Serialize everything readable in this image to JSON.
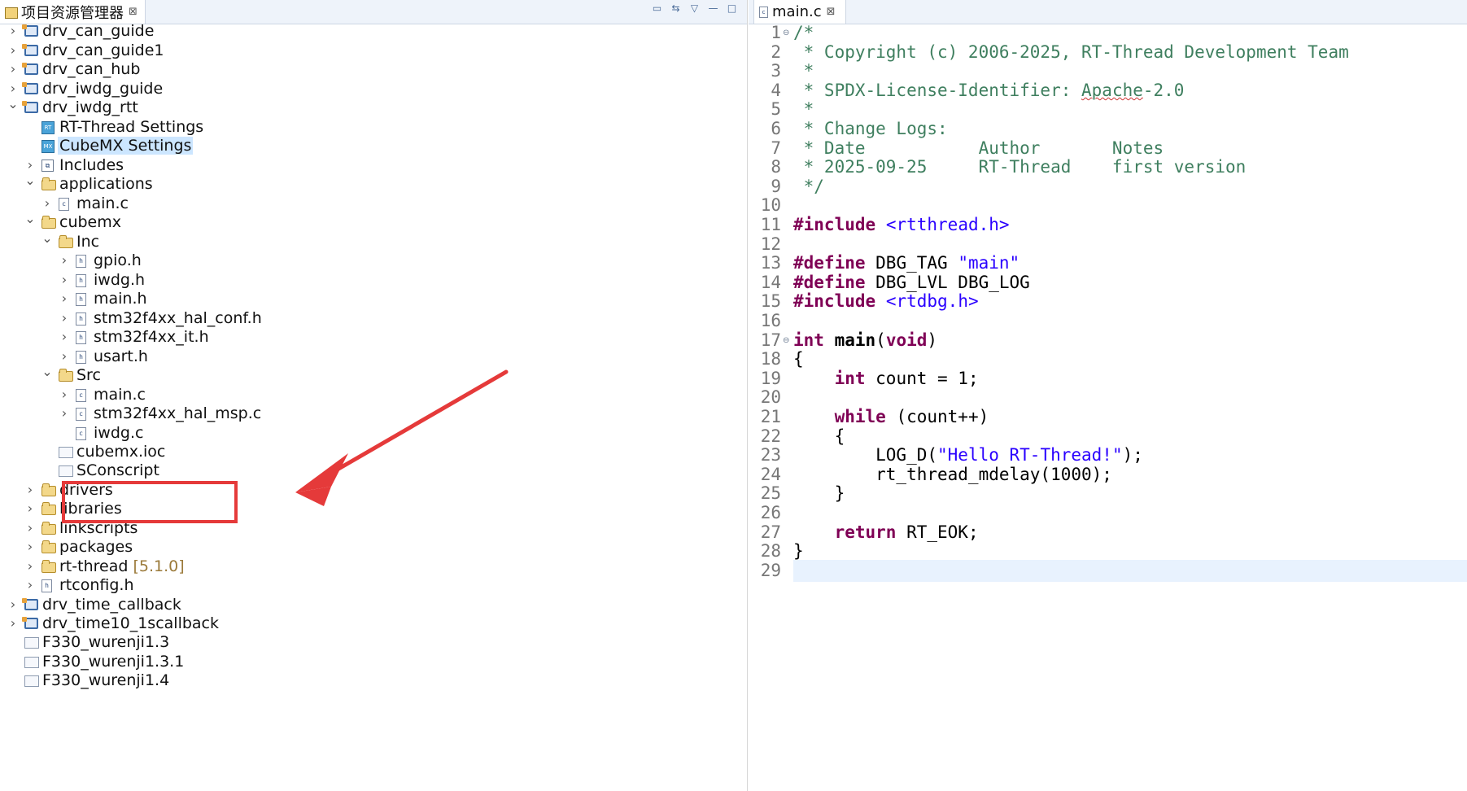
{
  "explorer": {
    "tab_title": "项目资源管理器",
    "tab_close": "⊠",
    "tools": [
      "▭",
      "⇆",
      "▽",
      "—",
      "□"
    ],
    "items": [
      {
        "label": "drv_can_guide",
        "version": ""
      },
      {
        "label": "drv_can_guide1",
        "version": ""
      },
      {
        "label": "drv_can_hub",
        "version": ""
      },
      {
        "label": "drv_iwdg_guide",
        "version": ""
      },
      {
        "label": "drv_iwdg_rtt",
        "version": ""
      },
      {
        "label": "RT-Thread Settings",
        "version": ""
      },
      {
        "label": "CubeMX Settings",
        "version": ""
      },
      {
        "label": "Includes",
        "version": ""
      },
      {
        "label": "applications",
        "version": ""
      },
      {
        "label": "main.c",
        "version": ""
      },
      {
        "label": "cubemx",
        "version": ""
      },
      {
        "label": "Inc",
        "version": ""
      },
      {
        "label": "gpio.h",
        "version": ""
      },
      {
        "label": "iwdg.h",
        "version": ""
      },
      {
        "label": "main.h",
        "version": ""
      },
      {
        "label": "stm32f4xx_hal_conf.h",
        "version": ""
      },
      {
        "label": "stm32f4xx_it.h",
        "version": ""
      },
      {
        "label": "usart.h",
        "version": ""
      },
      {
        "label": "Src",
        "version": ""
      },
      {
        "label": "main.c",
        "version": ""
      },
      {
        "label": "stm32f4xx_hal_msp.c",
        "version": ""
      },
      {
        "label": "iwdg.c",
        "version": ""
      },
      {
        "label": "cubemx.ioc",
        "version": ""
      },
      {
        "label": "SConscript",
        "version": ""
      },
      {
        "label": "drivers",
        "version": ""
      },
      {
        "label": "libraries",
        "version": ""
      },
      {
        "label": "linkscripts",
        "version": ""
      },
      {
        "label": "packages",
        "version": ""
      },
      {
        "label": "rt-thread",
        "version": "[5.1.0]"
      },
      {
        "label": "rtconfig.h",
        "version": ""
      },
      {
        "label": "drv_time_callback",
        "version": ""
      },
      {
        "label": "drv_time10_1scallback",
        "version": ""
      },
      {
        "label": "F330_wurenji1.3",
        "version": ""
      },
      {
        "label": "F330_wurenji1.3.1",
        "version": ""
      },
      {
        "label": "F330_wurenji1.4",
        "version": ""
      }
    ]
  },
  "editor": {
    "tab_title": "main.c",
    "tab_close": "⊠",
    "lines": [
      [
        {
          "t": "/*",
          "c": "c-comment"
        }
      ],
      [
        {
          "t": " * Copyright (c) 2006-2025, RT-Thread Development Team",
          "c": "c-comment"
        }
      ],
      [
        {
          "t": " *",
          "c": "c-comment"
        }
      ],
      [
        {
          "t": " * SPDX-License-Identifier: ",
          "c": "c-comment"
        },
        {
          "t": "Apache",
          "c": "c-comment c-link"
        },
        {
          "t": "-2.0",
          "c": "c-comment"
        }
      ],
      [
        {
          "t": " *",
          "c": "c-comment"
        }
      ],
      [
        {
          "t": " * Change Logs:",
          "c": "c-comment"
        }
      ],
      [
        {
          "t": " * Date           Author       Notes",
          "c": "c-comment"
        }
      ],
      [
        {
          "t": " * 2025-09-25     RT-Thread    first version",
          "c": "c-comment"
        }
      ],
      [
        {
          "t": " */",
          "c": "c-comment"
        }
      ],
      [],
      [
        {
          "t": "#include",
          "c": "c-kw"
        },
        {
          "t": " ",
          "c": "c-plain"
        },
        {
          "t": "<rtthread.h>",
          "c": "c-str"
        }
      ],
      [],
      [
        {
          "t": "#define",
          "c": "c-kw"
        },
        {
          "t": " DBG_TAG ",
          "c": "c-plain"
        },
        {
          "t": "\"main\"",
          "c": "c-str"
        }
      ],
      [
        {
          "t": "#define",
          "c": "c-kw"
        },
        {
          "t": " DBG_LVL DBG_LOG",
          "c": "c-plain"
        }
      ],
      [
        {
          "t": "#include",
          "c": "c-kw"
        },
        {
          "t": " ",
          "c": "c-plain"
        },
        {
          "t": "<rtdbg.h>",
          "c": "c-str"
        }
      ],
      [],
      [
        {
          "t": "int",
          "c": "c-kw"
        },
        {
          "t": " ",
          "c": "c-plain"
        },
        {
          "t": "main",
          "c": "c-plain c-bold"
        },
        {
          "t": "(",
          "c": "c-plain"
        },
        {
          "t": "void",
          "c": "c-kw"
        },
        {
          "t": ")",
          "c": "c-plain"
        }
      ],
      [
        {
          "t": "{",
          "c": "c-plain"
        }
      ],
      [
        {
          "t": "    ",
          "c": "c-plain"
        },
        {
          "t": "int",
          "c": "c-kw"
        },
        {
          "t": " count = 1;",
          "c": "c-plain"
        }
      ],
      [],
      [
        {
          "t": "    ",
          "c": "c-plain"
        },
        {
          "t": "while",
          "c": "c-kw"
        },
        {
          "t": " (count++)",
          "c": "c-plain"
        }
      ],
      [
        {
          "t": "    {",
          "c": "c-plain"
        }
      ],
      [
        {
          "t": "        LOG_D(",
          "c": "c-plain"
        },
        {
          "t": "\"Hello RT-Thread!\"",
          "c": "c-str"
        },
        {
          "t": ");",
          "c": "c-plain"
        }
      ],
      [
        {
          "t": "        rt_thread_mdelay(1000);",
          "c": "c-plain"
        }
      ],
      [
        {
          "t": "    }",
          "c": "c-plain"
        }
      ],
      [],
      [
        {
          "t": "    ",
          "c": "c-plain"
        },
        {
          "t": "return",
          "c": "c-kw"
        },
        {
          "t": " RT_EOK;",
          "c": "c-plain"
        }
      ],
      [
        {
          "t": "}",
          "c": "c-plain"
        }
      ],
      []
    ],
    "current_line": 29
  }
}
